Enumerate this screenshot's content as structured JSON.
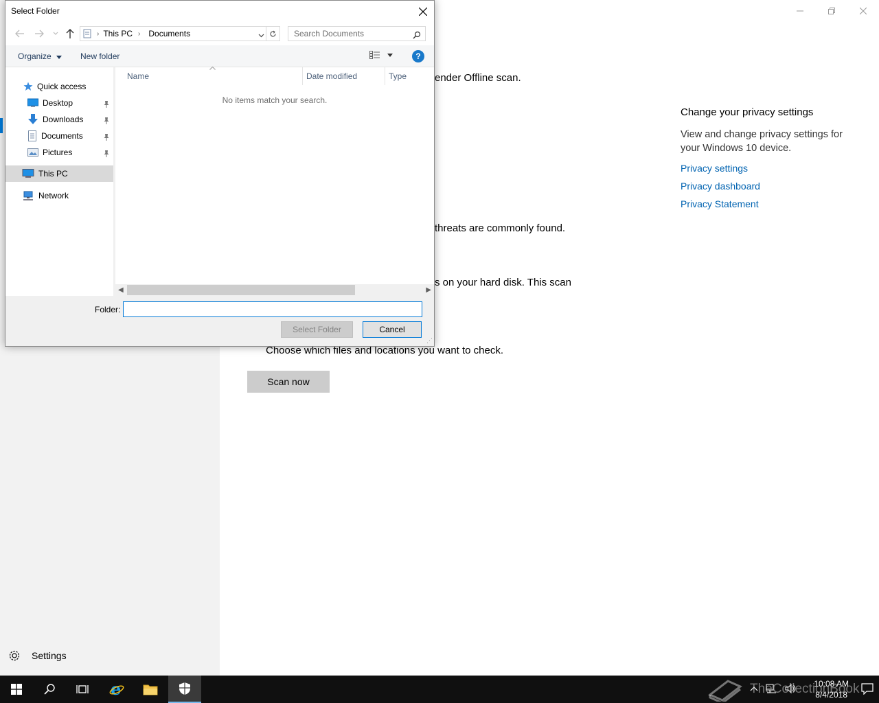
{
  "dialog": {
    "title": "Select Folder",
    "breadcrumb": [
      "This PC",
      "Documents"
    ],
    "search_placeholder": "Search Documents",
    "toolbar": {
      "organize": "Organize",
      "new_folder": "New folder"
    },
    "nav_tree": [
      {
        "label": "Quick access",
        "icon": "star-icon"
      },
      {
        "label": "Desktop",
        "icon": "desktop-folder-icon",
        "pinned": true
      },
      {
        "label": "Downloads",
        "icon": "downloads-arrow-icon",
        "pinned": true
      },
      {
        "label": "Documents",
        "icon": "document-icon",
        "pinned": true
      },
      {
        "label": "Pictures",
        "icon": "pictures-icon",
        "pinned": true
      },
      {
        "label": "This PC",
        "icon": "computer-icon",
        "selected": true
      },
      {
        "label": "Network",
        "icon": "network-icon"
      }
    ],
    "columns": [
      "Name",
      "Date modified",
      "Type"
    ],
    "empty_message": "No items match your search.",
    "folder_label": "Folder:",
    "folder_value": "",
    "buttons": {
      "select": "Select Folder",
      "cancel": "Cancel"
    }
  },
  "app": {
    "text_lines": [
      "ender Offline scan.",
      "threats are commonly found.",
      "s on your hard disk. This scan",
      "Choose which files and locations you want to check."
    ],
    "scan_button": "Scan now",
    "privacy": {
      "heading": "Change your privacy settings",
      "description": "View and change privacy settings for your Windows 10 device.",
      "links": [
        "Privacy settings",
        "Privacy dashboard",
        "Privacy Statement"
      ]
    },
    "settings_label": "Settings"
  },
  "taskbar": {
    "time": "10:08 AM",
    "date": "8/4/2018",
    "watermark": "TheCollectionBook"
  },
  "colors": {
    "accent": "#0078d7",
    "link": "#0063b1",
    "taskbar": "#101010"
  }
}
